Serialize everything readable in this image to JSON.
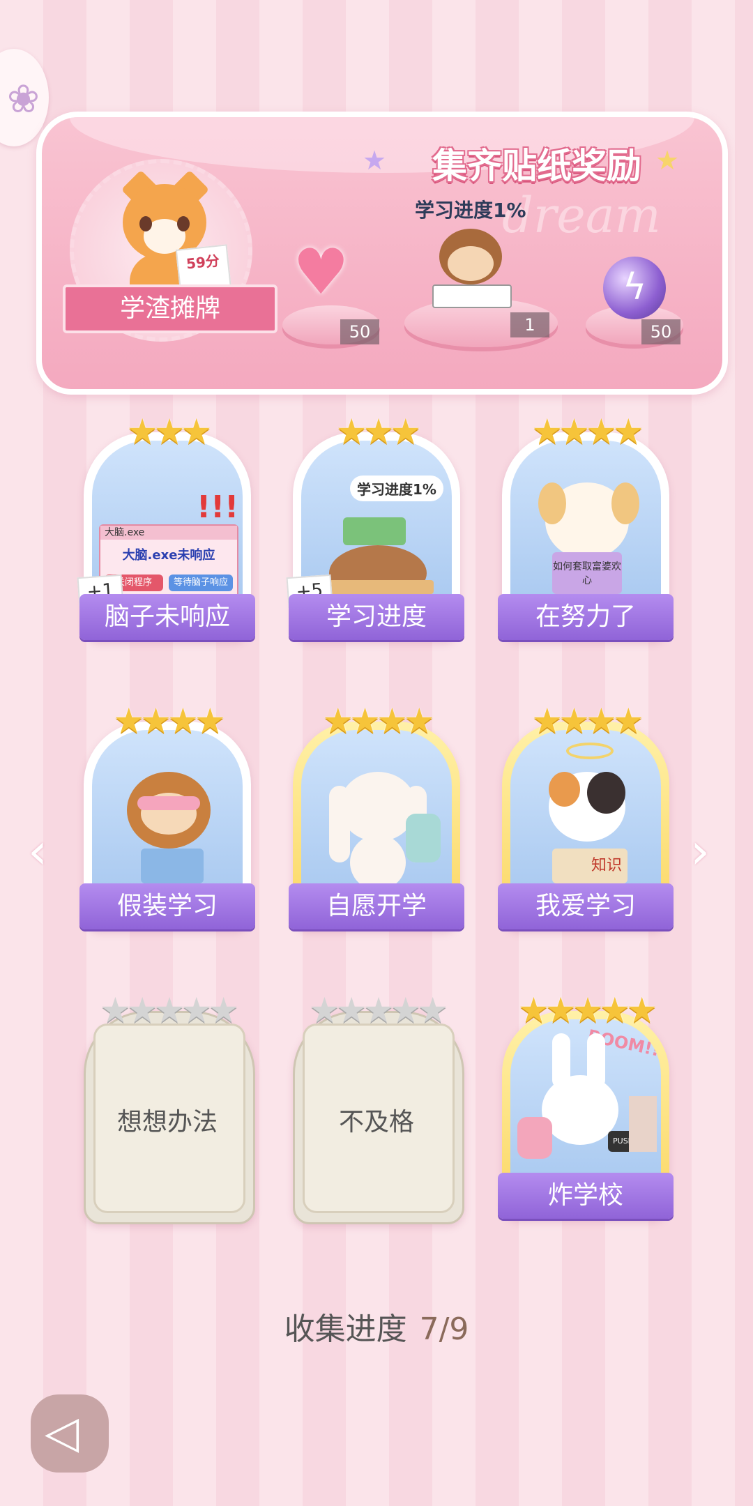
{
  "banner": {
    "title": "集齐贴纸奖励",
    "watermark": "dream",
    "player_title": "学渣摊牌",
    "paper_score": "59分",
    "progress_label": "学习进度1%",
    "rewards": [
      {
        "icon": "heart-gem-icon",
        "count": "50"
      },
      {
        "icon": "monkey-sticker-icon",
        "count": "1"
      },
      {
        "icon": "energy-orb-icon",
        "count": "50"
      }
    ]
  },
  "cards": [
    {
      "name": "脑子未响应",
      "stars": "★★★",
      "badge": "+1",
      "locked": false,
      "gold": false,
      "window_title": "大脑.exe",
      "window_msg": "大脑.exe未响应",
      "btn1": "关闭程序",
      "btn2": "等待脑子响应"
    },
    {
      "name": "学习进度",
      "stars": "★★★",
      "badge": "+5",
      "locked": false,
      "gold": false,
      "bubble": "学习进度1%"
    },
    {
      "name": "在努力了",
      "stars": "★★★★",
      "locked": false,
      "gold": false,
      "book_text": "如何套取富婆欢心"
    },
    {
      "name": "假装学习",
      "stars": "★★★★",
      "locked": false,
      "gold": false
    },
    {
      "name": "自愿开学",
      "stars": "★★★★",
      "locked": false,
      "gold": true
    },
    {
      "name": "我爱学习",
      "stars": "★★★★",
      "locked": false,
      "gold": true,
      "book_text": "知识"
    },
    {
      "name": "想想办法",
      "stars": "★★★★★",
      "locked": true
    },
    {
      "name": "不及格",
      "stars": "★★★★★",
      "locked": true
    },
    {
      "name": "炸学校",
      "stars": "★★★★★",
      "locked": false,
      "gold": true,
      "bubble": "BOOM!!",
      "button_text": "PUSH"
    }
  ],
  "collection": {
    "label": "收集进度",
    "value": "7/9"
  },
  "colors": {
    "accent_pink": "#e97196",
    "name_purple": "#9064d8",
    "gold_star": "#f6c43a"
  }
}
